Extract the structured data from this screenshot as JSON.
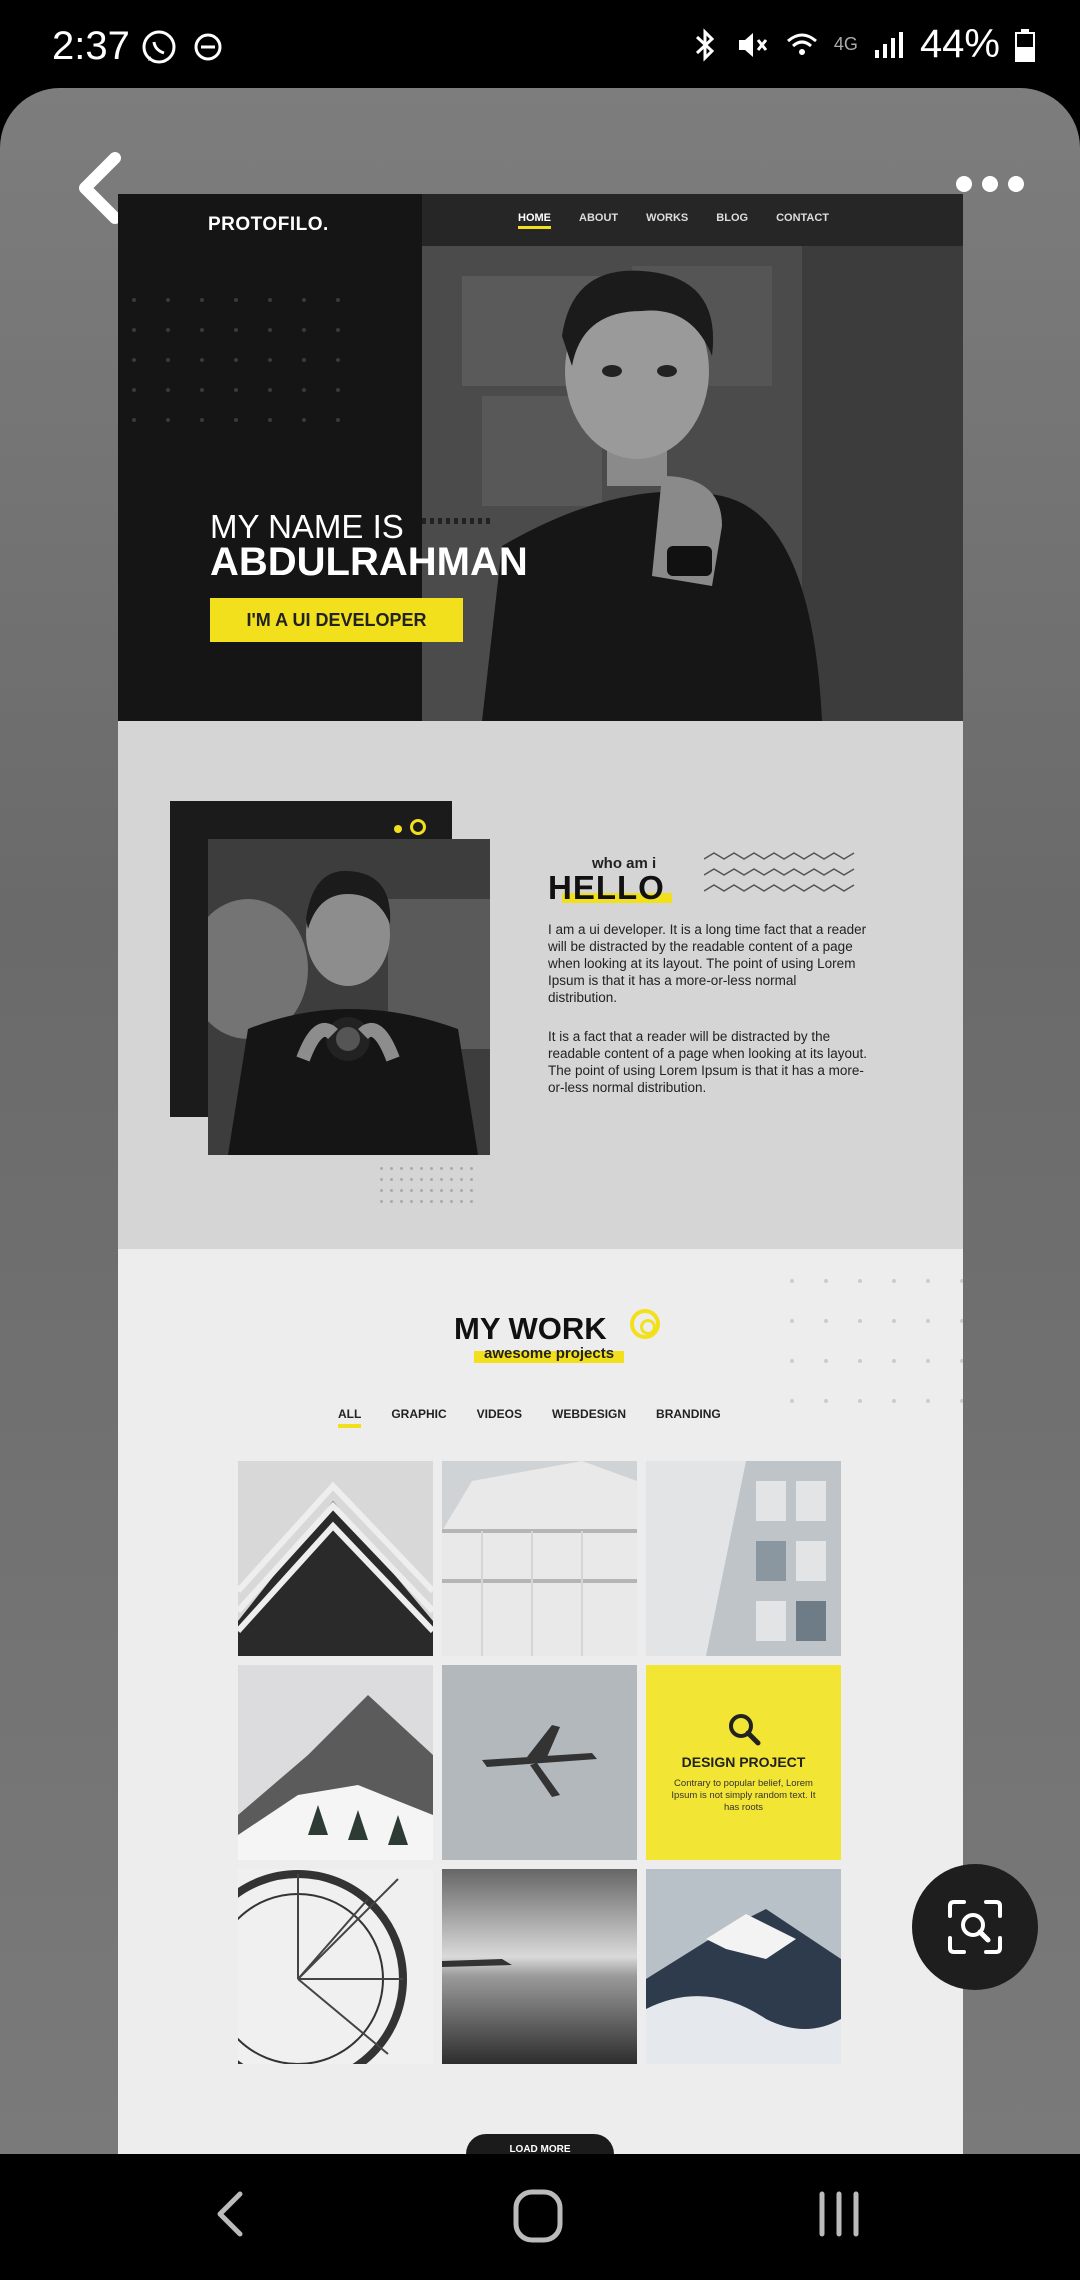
{
  "status_bar": {
    "time": "2:37",
    "battery": "44%",
    "network": "4G"
  },
  "viewer": {
    "back_icon": "chevron-left-icon",
    "more_icon": "more-dots-icon",
    "lens_icon": "lens-search-icon"
  },
  "site": {
    "logo": "PROTOFILO.",
    "nav": [
      "HOME",
      "ABOUT",
      "WORKS",
      "BLOG",
      "CONTACT"
    ],
    "hero": {
      "line1": "MY NAME IS",
      "line2": "ABDULRAHMAN",
      "button": "I'M A UI DEVELOPER"
    },
    "about": {
      "kicker": "who am i",
      "title": "HELLO",
      "para1": "I am a ui developer. It is a long time fact that a reader will be distracted by the readable content of a page when looking at its layout. The point of using Lorem Ipsum is that it has a more-or-less normal distribution.",
      "para2": "It is a fact that a reader will be distracted by the readable content of a page when looking at its layout. The point of using Lorem Ipsum is that it has a more-or-less normal distribution."
    },
    "work": {
      "title": "MY WORK",
      "subtitle": "awesome projects",
      "filters": [
        "ALL",
        "GRAPHIC",
        "VIDEOS",
        "WEBDESIGN",
        "BRANDING"
      ],
      "featured_title": "DESIGN PROJECT",
      "featured_desc": "Contrary to popular belief, Lorem Ipsum is not simply random text. It has roots",
      "load_more": "LOAD MORE"
    }
  },
  "colors": {
    "accent": "#f2e01c"
  }
}
